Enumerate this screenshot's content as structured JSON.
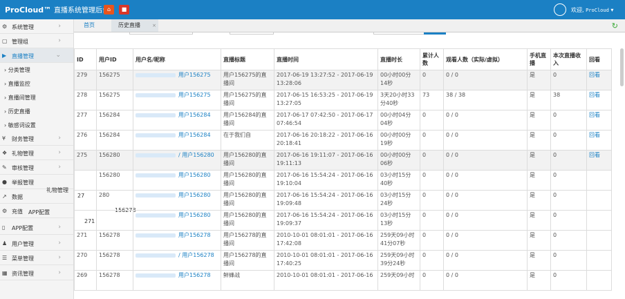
{
  "app": {
    "brand": "ProCloud™",
    "subtitle": "直播系统管理后台",
    "welcome": "欢迎,",
    "username": "ProCloud",
    "home_icon": "home-icon",
    "stop_icon": "stop-icon"
  },
  "sidebar": {
    "items": [
      {
        "label": "系统管理",
        "icon": "cog-icon"
      },
      {
        "label": "管理组",
        "icon": "monitor-icon"
      },
      {
        "label": "直播管理",
        "icon": "video-icon"
      },
      {
        "label": "财务管理",
        "icon": "yen-icon"
      },
      {
        "label": "礼物管理",
        "icon": "gift-icon"
      },
      {
        "label": "审核管理",
        "icon": "edit-icon"
      },
      {
        "label": "举报管理",
        "icon": "chat-icon"
      },
      {
        "label": "数据",
        "icon": "chart-icon"
      },
      {
        "label": "充值",
        "icon": "gear-icon"
      },
      {
        "label": "APP配置",
        "icon": "phone-icon"
      },
      {
        "label": "用户管理",
        "icon": "user-icon"
      },
      {
        "label": "菜单管理",
        "icon": "list-icon"
      },
      {
        "label": "资讯管理",
        "icon": "grid-icon"
      }
    ],
    "subitems": [
      "分类管理",
      "直播监控",
      "直播间管理",
      "历史直播",
      "敏感词设置"
    ],
    "ghost_labels": [
      "礼物管理",
      "APP配置",
      "27",
      "156278",
      "271"
    ]
  },
  "tabs": {
    "home": "首页",
    "history": "历史直播"
  },
  "table": {
    "headers": [
      "ID",
      "用户ID",
      "用户名/昵称",
      "直播标题",
      "直播时间",
      "直播时长",
      "累计人数",
      "观看人数（实际/虚拟）",
      "手机直播",
      "本次直播收入",
      "回看"
    ],
    "rows": [
      [
        "279",
        "156275",
        "用户156275",
        "用户156275的直播间",
        "2017-06-19 13:27:52 - 2017-06-19 13:28:06",
        "00小时00分14秒",
        "0",
        "0 / 0",
        "是",
        "0",
        "回看"
      ],
      [
        "278",
        "156275",
        "用户156275",
        "用户156275的直播间",
        "2017-06-15 16:53:25 - 2017-06-19 13:27:05",
        "3天20小时33分40秒",
        "73",
        "38 / 38",
        "是",
        "38",
        "回看"
      ],
      [
        "277",
        "156284",
        "用户156284",
        "用户156284的直播间",
        "2017-06-17 07:42:50 - 2017-06-17 07:46:54",
        "00小时04分04秒",
        "0",
        "0 / 0",
        "是",
        "0",
        "回看"
      ],
      [
        "276",
        "156284",
        "用户156284",
        "在于我们自",
        "2017-06-16 20:18:22 - 2017-06-16 20:18:41",
        "00小时00分19秒",
        "0",
        "0 / 0",
        "是",
        "0",
        "回看"
      ],
      [
        "275",
        "156280",
        "/ 用户156280",
        "用户156280的直播间",
        "2017-06-16 19:11:07 - 2017-06-16 19:11:13",
        "00小时00分06秒",
        "0",
        "0 / 0",
        "是",
        "0",
        "回看"
      ],
      [
        "",
        "156280",
        "用户156280",
        "用户156280的直播间",
        "2017-06-16 15:54:24 - 2017-06-16 19:10:04",
        "03小时15分40秒",
        "0",
        "0 / 0",
        "是",
        "0",
        ""
      ],
      [
        "",
        "280",
        "用户156280",
        "用户156280的直播间",
        "2017-06-16 15:54:24 - 2017-06-16 19:09:48",
        "03小时15分24秒",
        "0",
        "0 / 0",
        "是",
        "0",
        ""
      ],
      [
        "",
        "",
        "用户156280",
        "用户156280的直播间",
        "2017-06-16 15:54:24 - 2017-06-16 19:09:37",
        "03小时15分13秒",
        "0",
        "0 / 0",
        "是",
        "0",
        ""
      ],
      [
        "271",
        "156278",
        "用户156278",
        "用户156278的直播间",
        "2010-10-01 08:01:01 - 2017-06-16 17:42:08",
        "259天09小时41分07秒",
        "0",
        "0 / 0",
        "是",
        "0",
        ""
      ],
      [
        "270",
        "156278",
        "/ 用户156278",
        "用户156278的直播间",
        "2010-10-01 08:01:01 - 2017-06-16 17:40:25",
        "259天09小时39分24秒",
        "0",
        "0 / 0",
        "是",
        "0",
        ""
      ],
      [
        "269",
        "156278",
        "用户156278",
        "鲜蜂战",
        "2010-10-01 08:01:01 - 2017-06-16",
        "259天09小时",
        "0",
        "0 / 0",
        "是",
        "0",
        ""
      ]
    ]
  },
  "colors": {
    "topbar": "#1b80c4",
    "link": "#1b80c4",
    "home_btn": "#e8541c",
    "stop_btn": "#d9372a",
    "refresh": "#38a832"
  },
  "refresh_icon": "refresh-icon"
}
